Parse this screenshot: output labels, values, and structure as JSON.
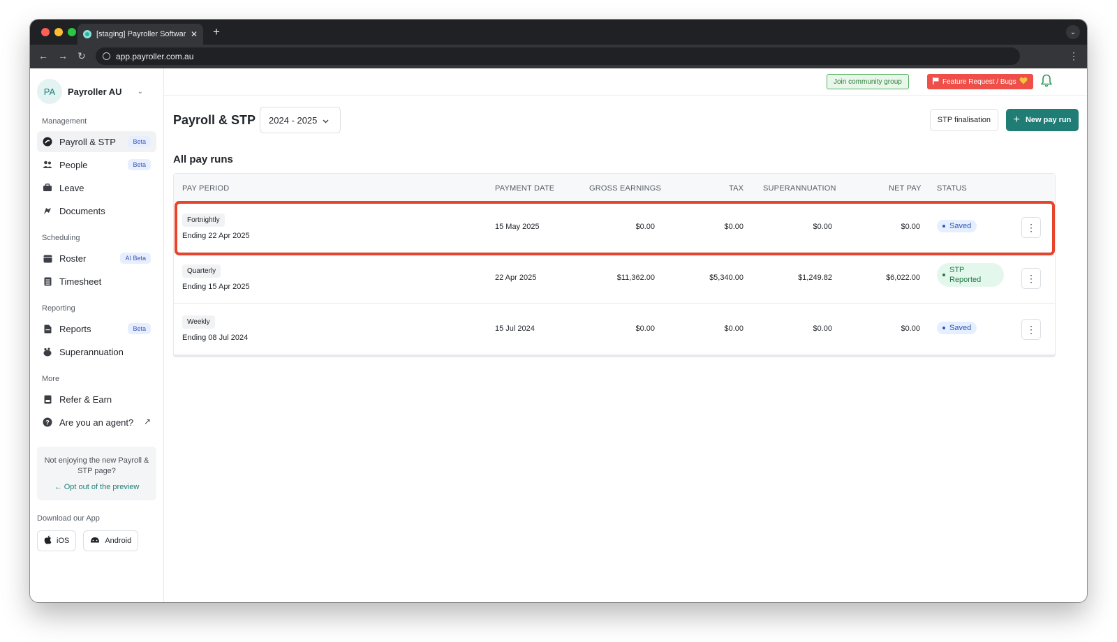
{
  "browser": {
    "tab_title": "[staging] Payroller Software",
    "tab_close": "✕",
    "new_tab": "+",
    "url": "app.payroller.com.au",
    "back": "←",
    "forward": "→",
    "reload": "↻",
    "menu": "⋮",
    "tab_menu": "⌄",
    "traffic_lights": [
      "#ff5f57",
      "#febc2e",
      "#28c840"
    ]
  },
  "sidebar": {
    "org_initials": "PA",
    "org_name": "Payroller AU",
    "org_chevron": "⌄",
    "sections": {
      "management": "Management",
      "scheduling": "Scheduling",
      "reporting": "Reporting",
      "more": "More"
    },
    "items": [
      {
        "label": "Payroll & STP",
        "badge": "Beta",
        "icon": "payroll-icon"
      },
      {
        "label": "People",
        "badge": "Beta",
        "icon": "people-icon"
      },
      {
        "label": "Leave",
        "icon": "leave-icon"
      },
      {
        "label": "Documents",
        "icon": "documents-icon"
      },
      {
        "label": "Roster",
        "badge": "AI Beta",
        "icon": "roster-icon"
      },
      {
        "label": "Timesheet",
        "icon": "timesheet-icon"
      },
      {
        "label": "Reports",
        "badge": "Beta",
        "icon": "reports-icon"
      },
      {
        "label": "Superannuation",
        "icon": "superannuation-icon"
      },
      {
        "label": "Refer & Earn",
        "icon": "refer-icon"
      },
      {
        "label": "Are you an agent?",
        "icon": "help-icon",
        "trailing": "↗"
      }
    ],
    "optout": {
      "text": "Not enjoying the new Payroll & STP page?",
      "link": "Opt out of the preview",
      "arrow": "←"
    },
    "download_label": "Download our App",
    "ios": "iOS",
    "android": "Android"
  },
  "topbar": {
    "join": "Join community group",
    "feature": "Feature Request / Bugs"
  },
  "header": {
    "title": "Payroll & STP",
    "year": "2024 - 2025",
    "year_chevron": "⌄",
    "stp_finalisation": "STP finalisation",
    "new_pay_run_plus": "+",
    "new_pay_run": "New pay run"
  },
  "table": {
    "title": "All pay runs",
    "columns": {
      "pay_period": "PAY PERIOD",
      "payment_date": "PAYMENT DATE",
      "gross": "GROSS EARNINGS",
      "tax": "TAX",
      "super": "SUPERANNUATION",
      "net": "NET PAY",
      "status": "STATUS"
    },
    "rows": [
      {
        "frequency": "Fortnightly",
        "ending": "Ending 22 Apr 2025",
        "payment_date": "15 May 2025",
        "gross": "$0.00",
        "tax": "$0.00",
        "super": "$0.00",
        "net": "$0.00",
        "status": "Saved"
      },
      {
        "frequency": "Quarterly",
        "ending": "Ending 15 Apr 2025",
        "payment_date": "22 Apr 2025",
        "gross": "$11,362.00",
        "tax": "$5,340.00",
        "super": "$1,249.82",
        "net": "$6,022.00",
        "status_line1": "STP",
        "status_line2": "Reported"
      },
      {
        "frequency": "Weekly",
        "ending": "Ending 08 Jul 2024",
        "payment_date": "15 Jul 2024",
        "gross": "$0.00",
        "tax": "$0.00",
        "super": "$0.00",
        "net": "$0.00",
        "status": "Saved"
      }
    ],
    "row_menu": "⋮"
  },
  "colors": {
    "accent": "#207d75",
    "highlight": "#e8442c",
    "feature_red": "#ee4f48",
    "join_green": "#55b160"
  }
}
